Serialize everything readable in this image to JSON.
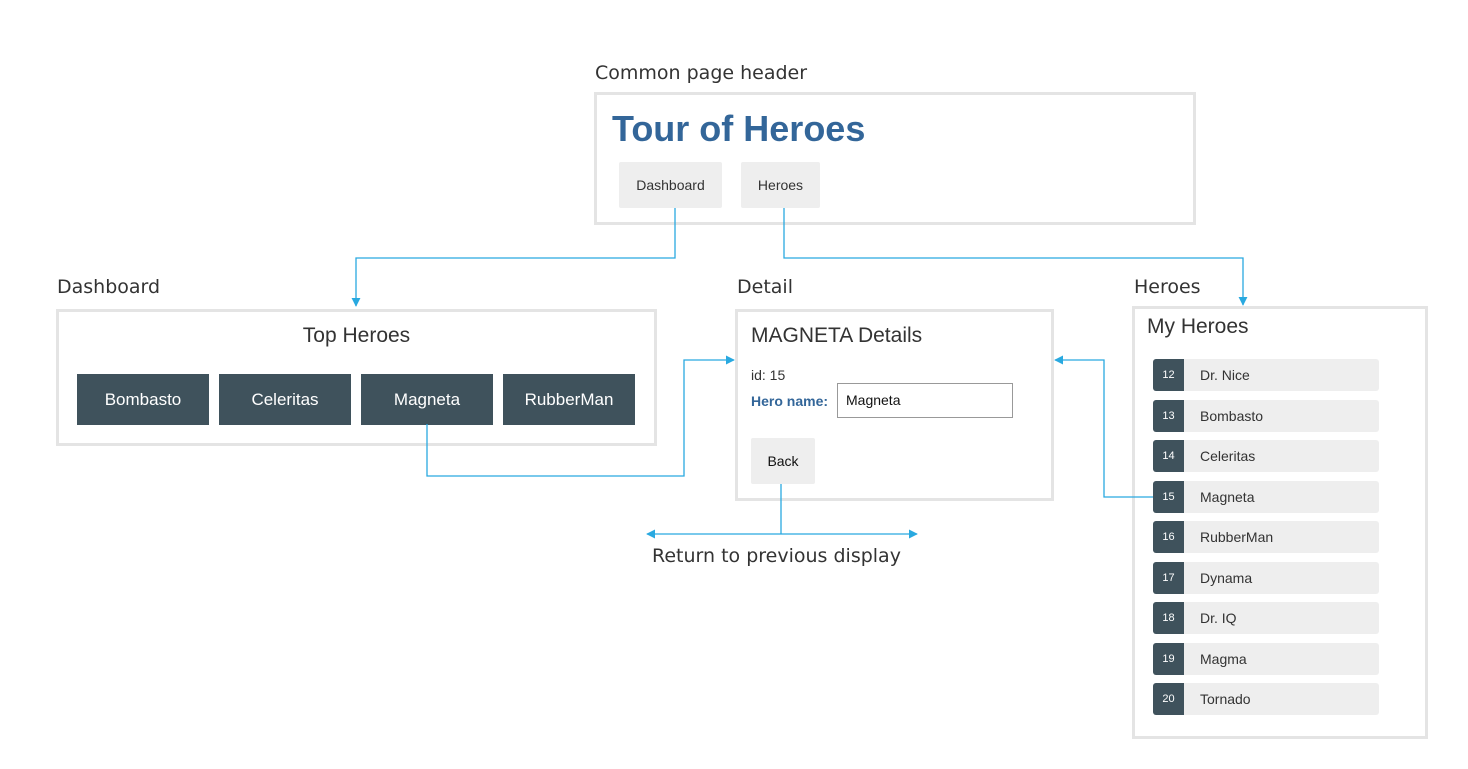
{
  "captions": {
    "header": "Common page header",
    "dashboard": "Dashboard",
    "detail": "Detail",
    "heroes": "Heroes",
    "return": "Return to previous display"
  },
  "header": {
    "title": "Tour of Heroes",
    "nav": [
      "Dashboard",
      "Heroes"
    ]
  },
  "dashboard": {
    "title": "Top Heroes",
    "heroes": [
      "Bombasto",
      "Celeritas",
      "Magneta",
      "RubberMan"
    ]
  },
  "detail": {
    "title": "MAGNETA Details",
    "id_text": "id: 15",
    "name_label": "Hero name:",
    "name_value": "Magneta",
    "back_label": "Back"
  },
  "heroes_list": {
    "title": "My Heroes",
    "items": [
      {
        "id": "12",
        "name": "Dr. Nice"
      },
      {
        "id": "13",
        "name": "Bombasto"
      },
      {
        "id": "14",
        "name": "Celeritas"
      },
      {
        "id": "15",
        "name": "Magneta"
      },
      {
        "id": "16",
        "name": "RubberMan"
      },
      {
        "id": "17",
        "name": "Dynama"
      },
      {
        "id": "18",
        "name": "Dr. IQ"
      },
      {
        "id": "19",
        "name": "Magma"
      },
      {
        "id": "20",
        "name": "Tornado"
      }
    ]
  },
  "colors": {
    "title_blue": "#336699",
    "tile_dark": "#3f525c",
    "connector": "#29a9e0",
    "panel_border": "#e4e4e4"
  }
}
